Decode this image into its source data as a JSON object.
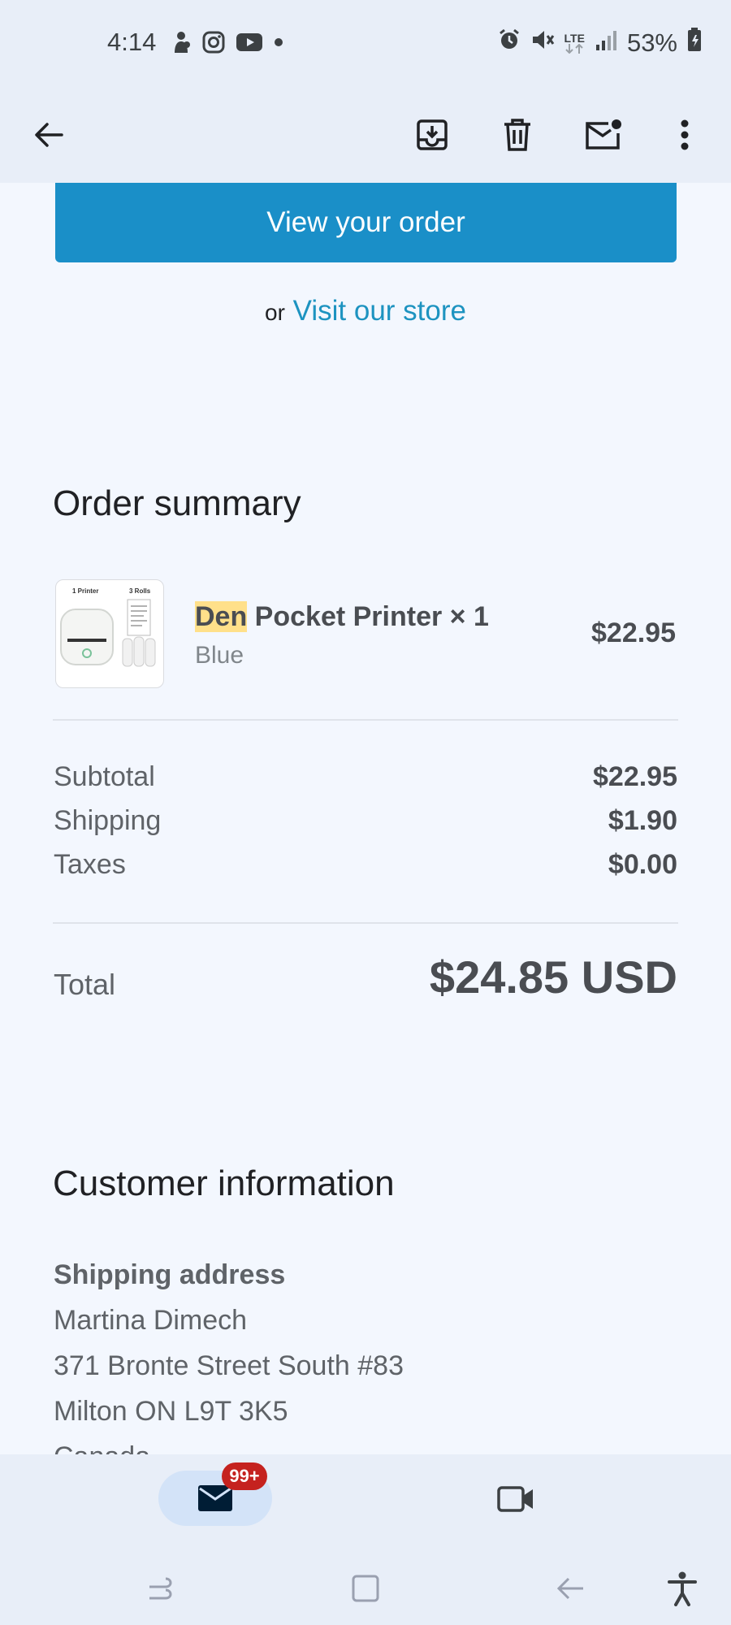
{
  "status_bar": {
    "time": "4:14",
    "left_icons": [
      "notification-figure-icon",
      "instagram-icon",
      "youtube-icon",
      "dot-icon"
    ],
    "right_icons": [
      "alarm-icon",
      "mute-icon",
      "lte-icon",
      "signal-icon"
    ],
    "lte_label": "LTE",
    "battery": "53%"
  },
  "toolbar": {
    "back": "back-arrow-icon",
    "actions": [
      "archive-icon",
      "delete-icon",
      "mark-unread-icon",
      "more-vert-icon"
    ]
  },
  "email": {
    "view_order_button": "View your order",
    "or_text": "or",
    "visit_store_link": "Visit our store",
    "order_summary_heading": "Order summary",
    "item": {
      "thumb_label_left": "1 Printer",
      "thumb_label_right": "3 Rolls",
      "name_highlight": "Den",
      "name_rest": " Pocket Printer × 1",
      "variant": "Blue",
      "price": "$22.95"
    },
    "totals": {
      "subtotal_label": "Subtotal",
      "subtotal_value": "$22.95",
      "shipping_label": "Shipping",
      "shipping_value": "$1.90",
      "taxes_label": "Taxes",
      "taxes_value": "$0.00",
      "total_label": "Total",
      "total_value": "$24.85 USD"
    },
    "customer_info_heading": "Customer information",
    "shipping_address_heading": "Shipping address",
    "address_lines": [
      "Martina Dimech",
      "371 Bronte Street South #83",
      "Milton ON L9T 3K5",
      "Canada"
    ]
  },
  "bottom_nav": {
    "mail_badge": "99+",
    "items": [
      "mail-icon",
      "video-icon"
    ]
  },
  "system_nav": [
    "recents-icon",
    "home-icon",
    "back-icon",
    "accessibility-icon"
  ],
  "colors": {
    "primary_button": "#1a8fc8",
    "link": "#1d93c0",
    "highlight": "#ffe08a",
    "badge": "#c5221f"
  }
}
